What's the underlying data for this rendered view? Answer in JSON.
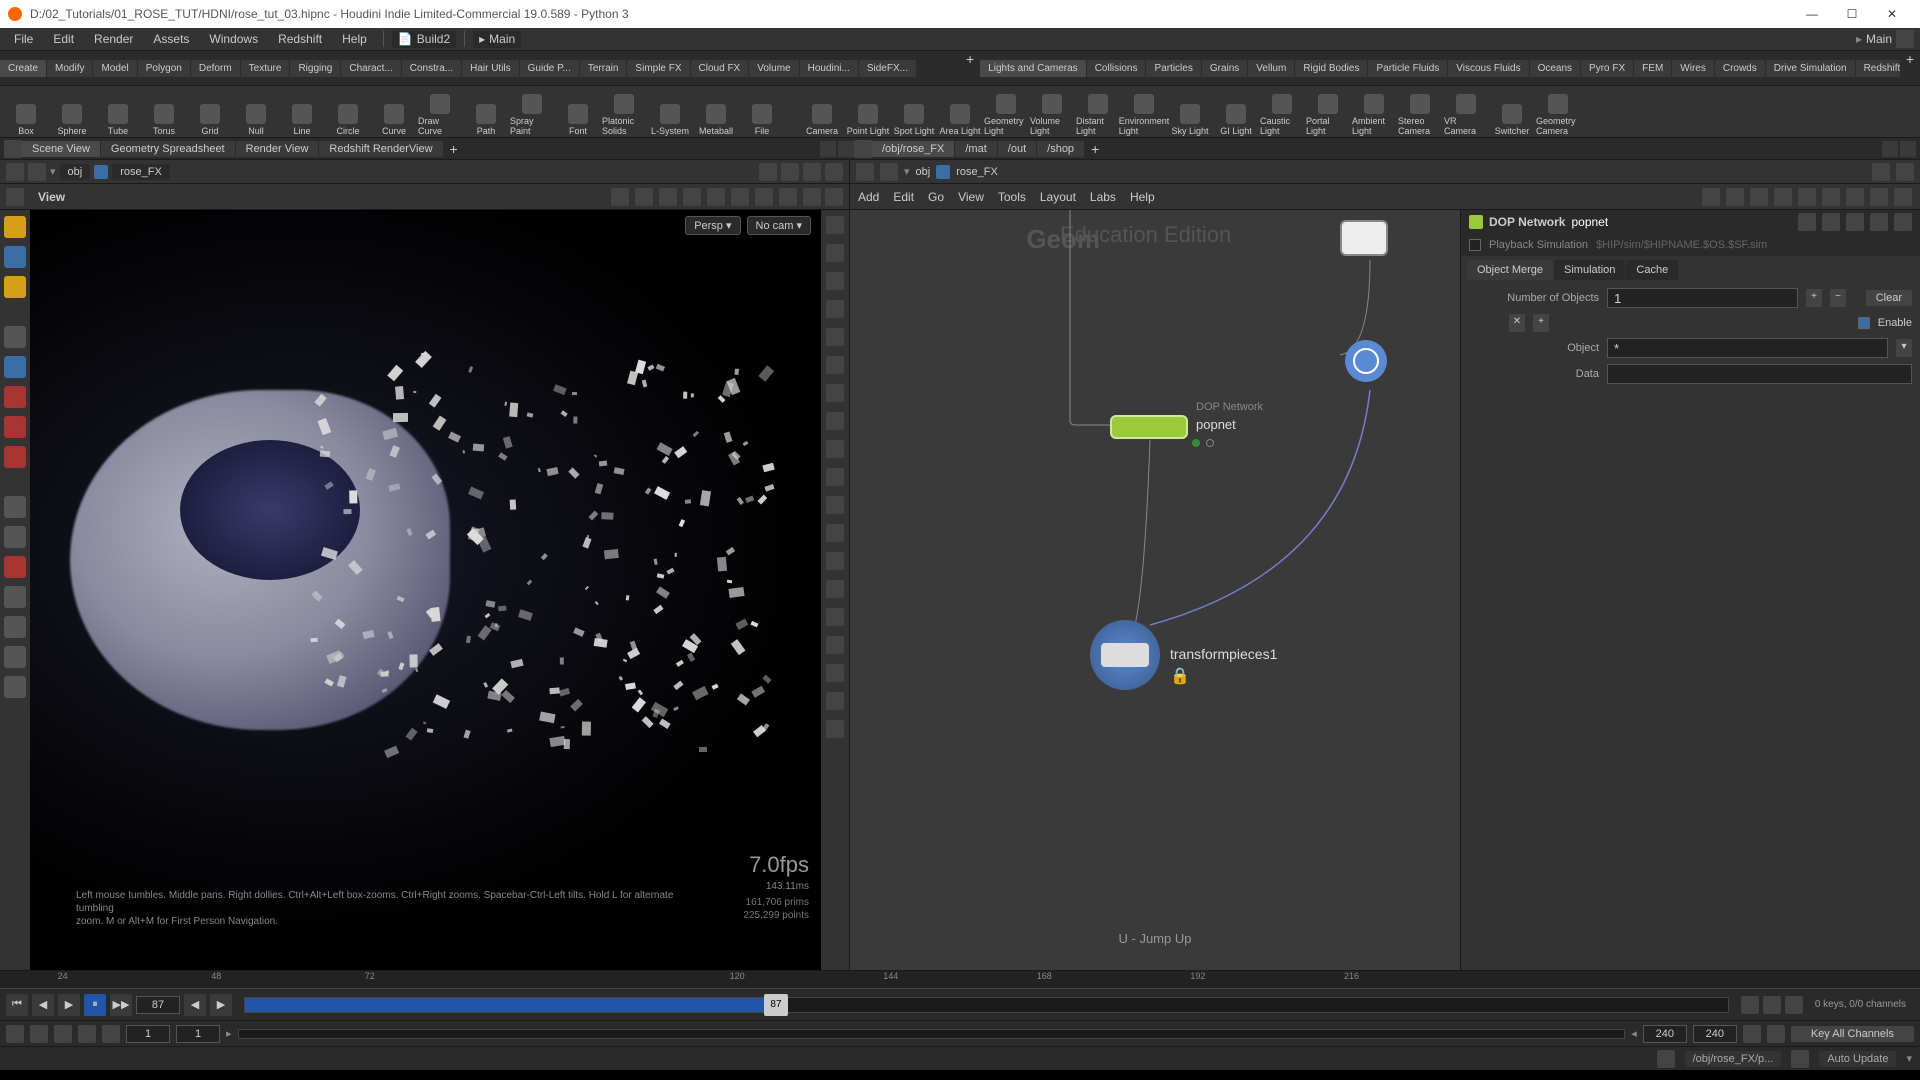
{
  "title": "D:/02_Tutorials/01_ROSE_TUT/HDNI/rose_tut_03.hipnc - Houdini Indie Limited-Commercial 19.0.589 - Python 3",
  "menubar": [
    "File",
    "Edit",
    "Render",
    "Assets",
    "Windows",
    "Redshift",
    "Help"
  ],
  "build_label": "Build2",
  "desktop_label": "Main",
  "desktop_label_right": "Main",
  "shelf_tabs_left": [
    "Create",
    "Modify",
    "Model",
    "Polygon",
    "Deform",
    "Texture",
    "Rigging",
    "Charact...",
    "Constra...",
    "Hair Utils",
    "Guide P...",
    "Terrain",
    "Simple FX",
    "Cloud FX",
    "Volume",
    "Houdini...",
    "SideFX..."
  ],
  "shelf_tabs_right": [
    "Lights and Cameras",
    "Collisions",
    "Particles",
    "Grains",
    "Vellum",
    "Rigid Bodies",
    "Particle Fluids",
    "Viscous Fluids",
    "Oceans",
    "Pyro FX",
    "FEM",
    "Wires",
    "Crowds",
    "Drive Simulation",
    "Redshift"
  ],
  "tools_left": [
    "Box",
    "Sphere",
    "Tube",
    "Torus",
    "Grid",
    "Null",
    "Line",
    "Circle",
    "Curve",
    "Draw Curve",
    "Path",
    "Spray Paint",
    "Font",
    "Platonic Solids",
    "L-System",
    "Metaball",
    "File"
  ],
  "tools_right": [
    "Camera",
    "Point Light",
    "Spot Light",
    "Area Light",
    "Geometry Light",
    "Volume Light",
    "Distant Light",
    "Environment Light",
    "Sky Light",
    "GI Light",
    "Caustic Light",
    "Portal Light",
    "Ambient Light",
    "Stereo Camera",
    "VR Camera",
    "Switcher",
    "Geometry Camera"
  ],
  "pane_tabs_left": [
    "Scene View",
    "Geometry Spreadsheet",
    "Render View",
    "Redshift RenderView"
  ],
  "pane_tabs_right": [
    "/obj/rose_FX",
    "/mat",
    "/out",
    "/shop"
  ],
  "scene_path": {
    "level": "obj",
    "node": "rose_FX"
  },
  "view_label": "View",
  "persp": "Persp",
  "cam": "No cam",
  "fps": "7.0fps",
  "frametime": "143.11ms",
  "stats1": "161,706  prims",
  "stats2": "225,299  points",
  "hint1": "Left mouse tumbles. Middle pans. Right dollies. Ctrl+Alt+Left box-zooms. Ctrl+Right zooms. Spacebar-Ctrl-Left tilts. Hold L for alternate tumbling",
  "hint2": "zoom.    M or Alt+M for First Person Navigation.",
  "net_menu": [
    "Add",
    "Edit",
    "Go",
    "View",
    "Tools",
    "Layout",
    "Labs",
    "Help"
  ],
  "net_path": {
    "level": "obj",
    "node": "rose_FX"
  },
  "watermark": "Education Edition",
  "watermark2": "Geom",
  "jump_hint": "U - Jump Up",
  "nodes": {
    "popnet": {
      "type": "DOP Network",
      "name": "popnet"
    },
    "transform": {
      "name": "transformpieces1"
    }
  },
  "params": {
    "nodetype": "DOP Network",
    "nodename": "popnet",
    "playback_label": "Playback Simulation",
    "cache_path": "$HIP/sim/$HIPNAME.$OS.$SF.sim",
    "tabs": [
      "Object Merge",
      "Simulation",
      "Cache"
    ],
    "numobj_label": "Number of Objects",
    "numobj": "1",
    "clear": "Clear",
    "enable_label": "Enable",
    "object_label": "Object",
    "object_val": "*",
    "data_label": "Data"
  },
  "timeline": {
    "ticks": [
      "24",
      "48",
      "72",
      "120",
      "144",
      "168",
      "192",
      "216"
    ],
    "current": "87",
    "start": "1",
    "start2": "1",
    "end": "240",
    "end2": "240",
    "keys": "0 keys, 0/0 channels",
    "keyall": "Key All Channels"
  },
  "status": {
    "path": "/obj/rose_FX/p...",
    "update": "Auto Update"
  }
}
